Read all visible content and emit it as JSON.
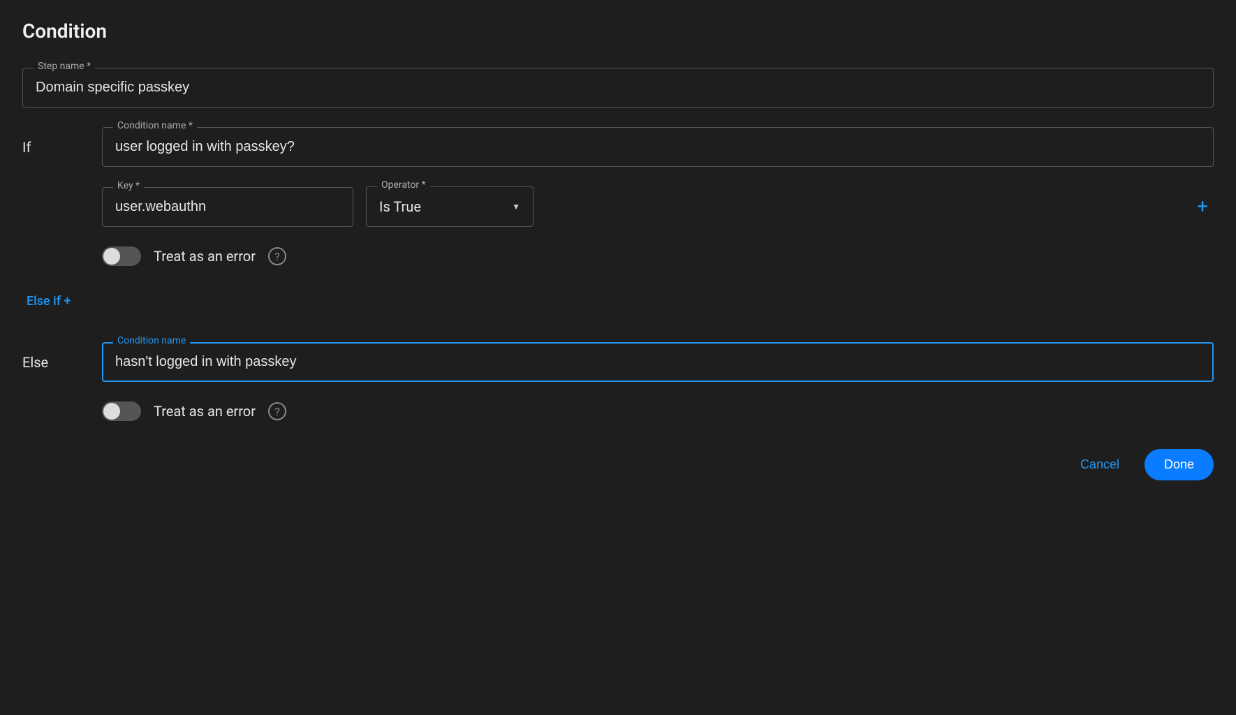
{
  "title": "Condition",
  "step_name": {
    "label": "Step name *",
    "value": "Domain specific passkey"
  },
  "if_branch": {
    "label": "If",
    "condition_name": {
      "label": "Condition name *",
      "value": "user logged in with passkey?"
    },
    "key": {
      "label": "Key *",
      "value": "user.webauthn"
    },
    "operator": {
      "label": "Operator *",
      "value": "Is True"
    },
    "treat_as_error": {
      "label": "Treat as an error",
      "on": false
    }
  },
  "elseif_link": "Else if +",
  "else_branch": {
    "label": "Else",
    "condition_name": {
      "label": "Condition name",
      "value": "hasn't logged in with passkey"
    },
    "treat_as_error": {
      "label": "Treat as an error",
      "on": false
    }
  },
  "footer": {
    "cancel": "Cancel",
    "done": "Done"
  }
}
